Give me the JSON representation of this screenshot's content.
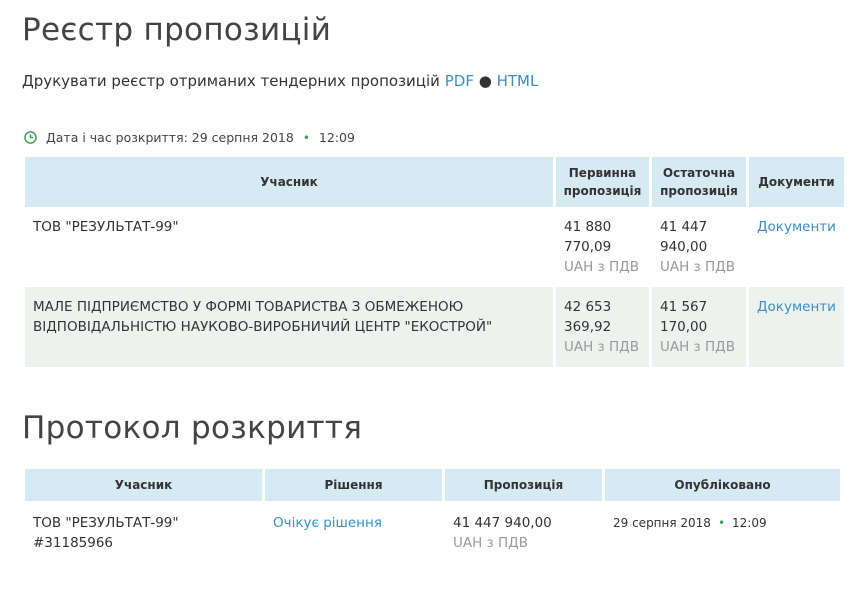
{
  "register": {
    "title": "Реєстр пропозицій",
    "print_text": "Друкувати реєстр отриманих тендерних пропозицій",
    "pdf_label": "PDF",
    "separator": "●",
    "html_label": "HTML",
    "opened_label": "Дата і час розкриття: 29 серпня 2018",
    "opened_time": "12:09",
    "headers": {
      "participant": "Учасник",
      "initial": "Первинна пропозиція",
      "final": "Остаточна пропозиція",
      "documents": "Документи"
    },
    "rows": [
      {
        "participant": "ТОВ \"РЕЗУЛЬТАТ-99\"",
        "initial_l1": "41 880",
        "initial_l2": "770,09",
        "initial_cur": "UAH з ПДВ",
        "final_l1": "41 447",
        "final_l2": "940,00",
        "final_cur": "UAH з ПДВ",
        "documents": "Документи"
      },
      {
        "participant": "МАЛЕ ПІДПРИЄМСТВО У ФОРМІ ТОВАРИСТВА З ОБМЕЖЕНОЮ ВІДПОВІДАЛЬНІСТЮ НАУКОВО-ВИРОБНИЧИЙ ЦЕНТР \"ЕКОСТРОЙ\"",
        "initial_l1": "42 653",
        "initial_l2": "369,92",
        "initial_cur": "UAH з ПДВ",
        "final_l1": "41 567",
        "final_l2": "170,00",
        "final_cur": "UAH з ПДВ",
        "documents": "Документи"
      }
    ]
  },
  "protocol": {
    "title": "Протокол розкриття",
    "headers": {
      "participant": "Учасник",
      "decision": "Рішення",
      "offer": "Пропозиція",
      "published": "Опубліковано"
    },
    "rows": [
      {
        "participant": "ТОВ \"РЕЗУЛЬТАТ-99\"",
        "participant_id": "#31185966",
        "decision": "Очікує рішення",
        "offer": "41 447 940,00",
        "offer_cur": "UAH з ПДВ",
        "published_date": "29 серпня 2018",
        "published_time": "12:09"
      }
    ]
  },
  "colors": {
    "header_bg": "#d5eaf2",
    "link": "#3a8fc4",
    "row_alt": "#eef2ef",
    "accent_green": "#3aa655"
  }
}
